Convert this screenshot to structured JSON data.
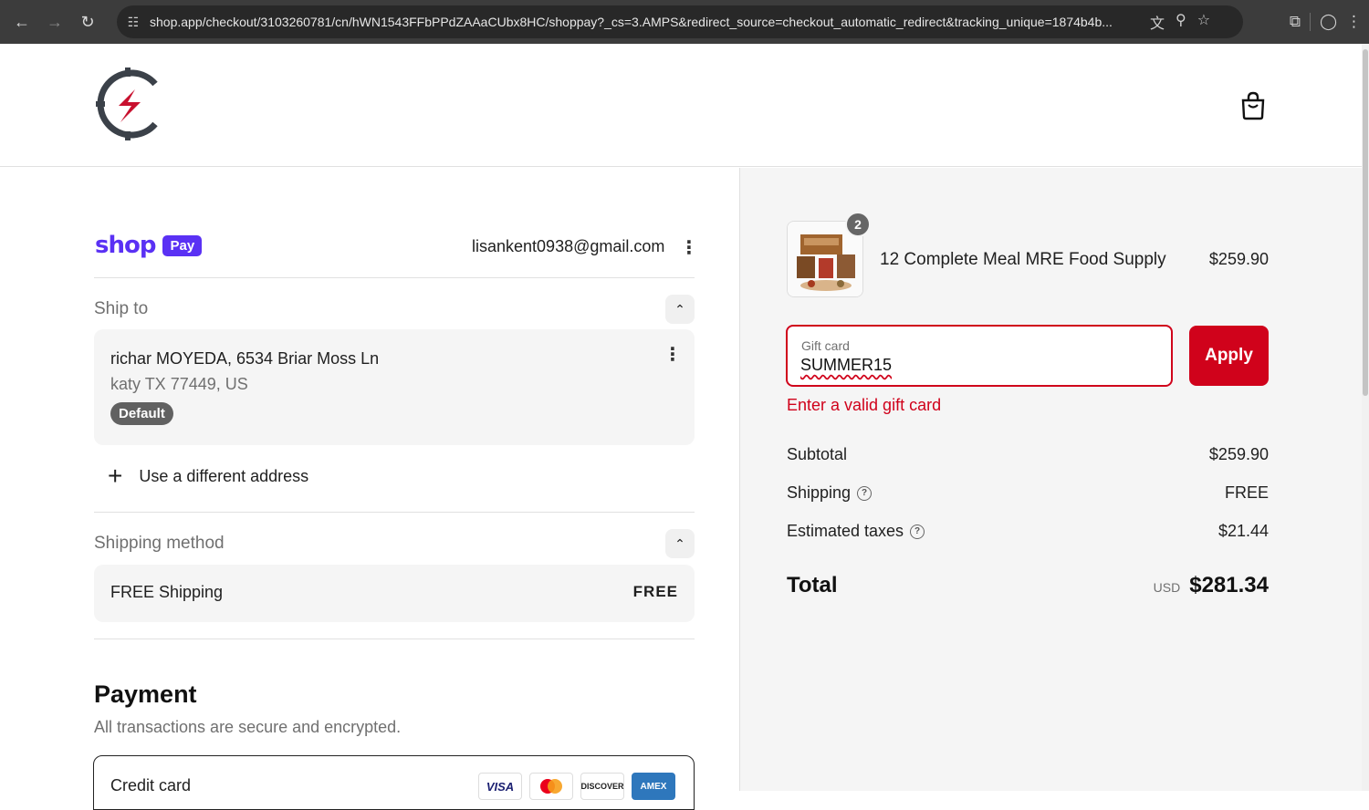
{
  "browser": {
    "url": "shop.app/checkout/3103260781/cn/hWN1543FFbPPdZAAaCUbx8HC/shoppay?_cs=3.AMPS&redirect_source=checkout_automatic_redirect&tracking_unique=1874b4b..."
  },
  "header": {
    "logo_icon": "store-logo",
    "cart_icon": "shopping-bag-icon"
  },
  "account": {
    "brand_word": "shop",
    "brand_pay": "Pay",
    "email": "lisankent0938@gmail.com"
  },
  "ship_to": {
    "title": "Ship to",
    "address_line1": "richar MOYEDA, 6534 Briar Moss Ln",
    "address_line2": "katy TX 77449, US",
    "badge": "Default",
    "use_different": "Use a different address"
  },
  "shipping_method": {
    "title": "Shipping method",
    "name": "FREE Shipping",
    "price": "FREE"
  },
  "payment": {
    "title": "Payment",
    "subtitle": "All transactions are secure and encrypted.",
    "credit_card_label": "Credit card",
    "cards": [
      "VISA",
      "",
      "DISCOVER",
      "AMEX"
    ]
  },
  "order": {
    "item_quantity": "2",
    "item_name": "12 Complete Meal MRE Food Supply",
    "item_price": "$259.90",
    "gift_card_label": "Gift card",
    "gift_card_value": "SUMMER15",
    "apply_label": "Apply",
    "gift_error": "Enter a valid gift card",
    "subtotal_label": "Subtotal",
    "subtotal": "$259.90",
    "shipping_label": "Shipping",
    "shipping": "FREE",
    "taxes_label": "Estimated taxes",
    "taxes": "$21.44",
    "total_label": "Total",
    "currency": "USD",
    "total": "$281.34"
  },
  "colors": {
    "accent": "#d0021b",
    "shoppay": "#5a31f4"
  }
}
